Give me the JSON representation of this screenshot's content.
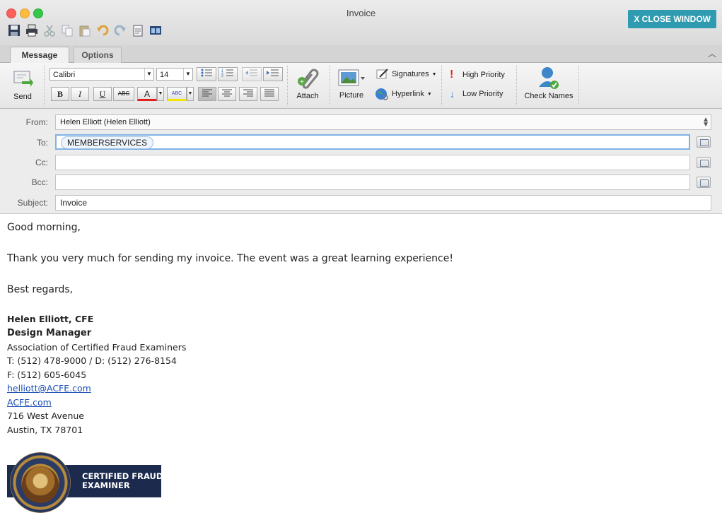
{
  "window": {
    "title": "Invoice",
    "close_label": "X CLOSE WINDOW"
  },
  "quick_access": [
    "save-icon",
    "print-icon",
    "cut-icon",
    "copy-icon",
    "paste-icon",
    "undo-icon",
    "redo-icon",
    "clipboard-icon",
    "window-icon"
  ],
  "tabs": [
    {
      "label": "Message"
    },
    {
      "label": "Options"
    }
  ],
  "ribbon": {
    "send": "Send",
    "font_name": "Calibri",
    "font_size": "14",
    "bold": "B",
    "italic": "I",
    "underline": "U",
    "strike": "ABC",
    "font_color": "A",
    "highlight": "ABC",
    "attach": "Attach",
    "picture": "Picture",
    "signatures": "Signatures",
    "hyperlink": "Hyperlink",
    "high_priority": "High Priority",
    "low_priority": "Low Priority",
    "check_names": "Check Names"
  },
  "fields": {
    "from_label": "From:",
    "from_value": "Helen Elliott (Helen Elliott)",
    "to_label": "To:",
    "to_value": "MEMBERSERVICES",
    "cc_label": "Cc:",
    "cc_value": "",
    "bcc_label": "Bcc:",
    "bcc_value": "",
    "subject_label": "Subject:",
    "subject_value": "Invoice"
  },
  "message": {
    "greeting": "Good morning,",
    "line1": "Thank you very much for sending my invoice. The event was a great learning experience!",
    "closing": "Best regards,"
  },
  "signature": {
    "name": "Helen Elliott, CFE",
    "title": "Design Manager",
    "org": "Association of Certified Fraud Examiners",
    "phone": "T: (512) 478-9000 / D: (512) 276-8154",
    "fax": "F: (512) 605-6045",
    "email": "helliott@ACFE.com",
    "website": "ACFE.com",
    "street": "716 West Avenue",
    "city": "Austin, TX 78701",
    "badge_line1": "CERTIFIED FRAUD",
    "badge_line2": "EXAMINER"
  }
}
